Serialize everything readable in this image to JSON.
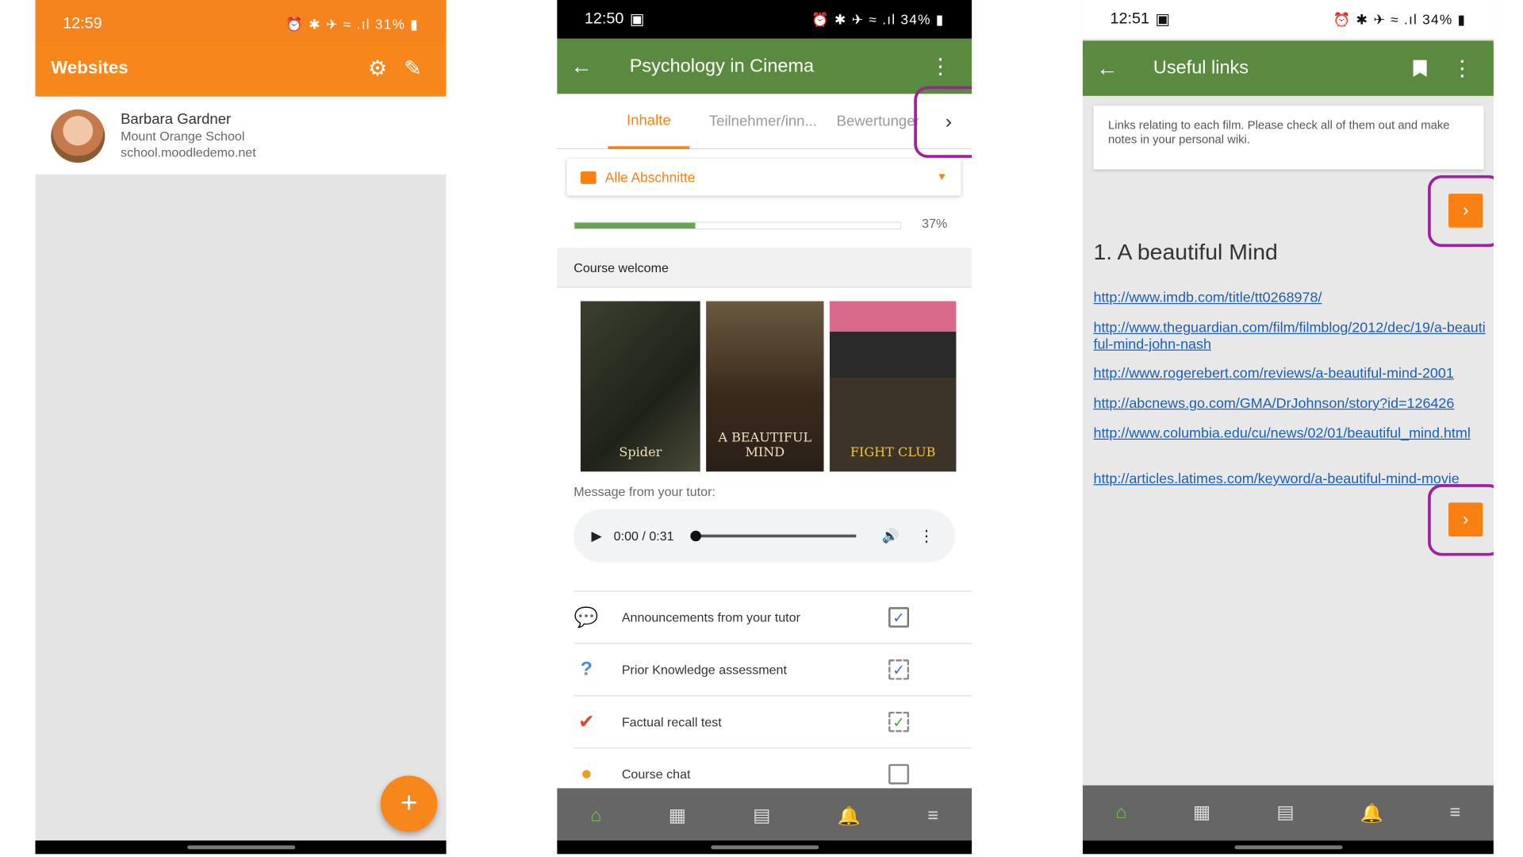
{
  "phone1": {
    "status_time": "12:59",
    "status_icons": "⏰ ✱ ✈ ≈ .ıl 31% ▮",
    "title": "Websites",
    "site": {
      "name": "Barbara Gardner",
      "school": "Mount Orange School",
      "url": "school.moodledemo.net"
    },
    "fab_label": "+"
  },
  "phone2": {
    "status_time": "12:50",
    "status_icons": "⏰ ✱ ✈ ≈ .ıl 34% ▮",
    "title": "Psychology in Cinema",
    "tabs": [
      "Inhalte",
      "Teilnehmer/inn...",
      "Bewertungen"
    ],
    "section_select": "Alle Abschnitte",
    "progress": 0.37,
    "progress_label": "37%",
    "section_title": "Course welcome",
    "posters": [
      "Spider",
      "A BEAUTIFUL MIND",
      "FIGHT CLUB"
    ],
    "message_label": "Message from your tutor:",
    "audio_time": "0:00 / 0:31",
    "activities": [
      {
        "label": "Announcements from your tutor",
        "icon": "forum-icon"
      },
      {
        "label": "Prior Knowledge assessment",
        "icon": "question-icon"
      },
      {
        "label": "Factual recall test",
        "icon": "quiz-icon"
      },
      {
        "label": "Course chat",
        "icon": "chat-icon"
      }
    ]
  },
  "phone3": {
    "status_time": "12:51",
    "status_icons": "⏰ ✱ ✈ ≈ .ıl 34% ▮",
    "title": "Useful links",
    "note": "Links relating to each film. Please check all of them out and make notes in your personal wiki.",
    "heading": "1. A beautiful Mind",
    "links": [
      "http://www.imdb.com/title/tt0268978/",
      "http://www.theguardian.com/film/filmblog/2012/dec/19/a-beautiful-mind-john-nash",
      "http://www.rogerebert.com/reviews/a-beautiful-mind-2001",
      "http://abcnews.go.com/GMA/DrJohnson/story?id=126426",
      "http://www.columbia.edu/cu/news/02/01/beautiful_mind.html",
      "http://articles.latimes.com/keyword/a-beautiful-mind-movie"
    ]
  },
  "colors": {
    "moodle_orange": "#f98012",
    "green_bar": "#5a8a3f",
    "highlight": "#a020a0"
  }
}
